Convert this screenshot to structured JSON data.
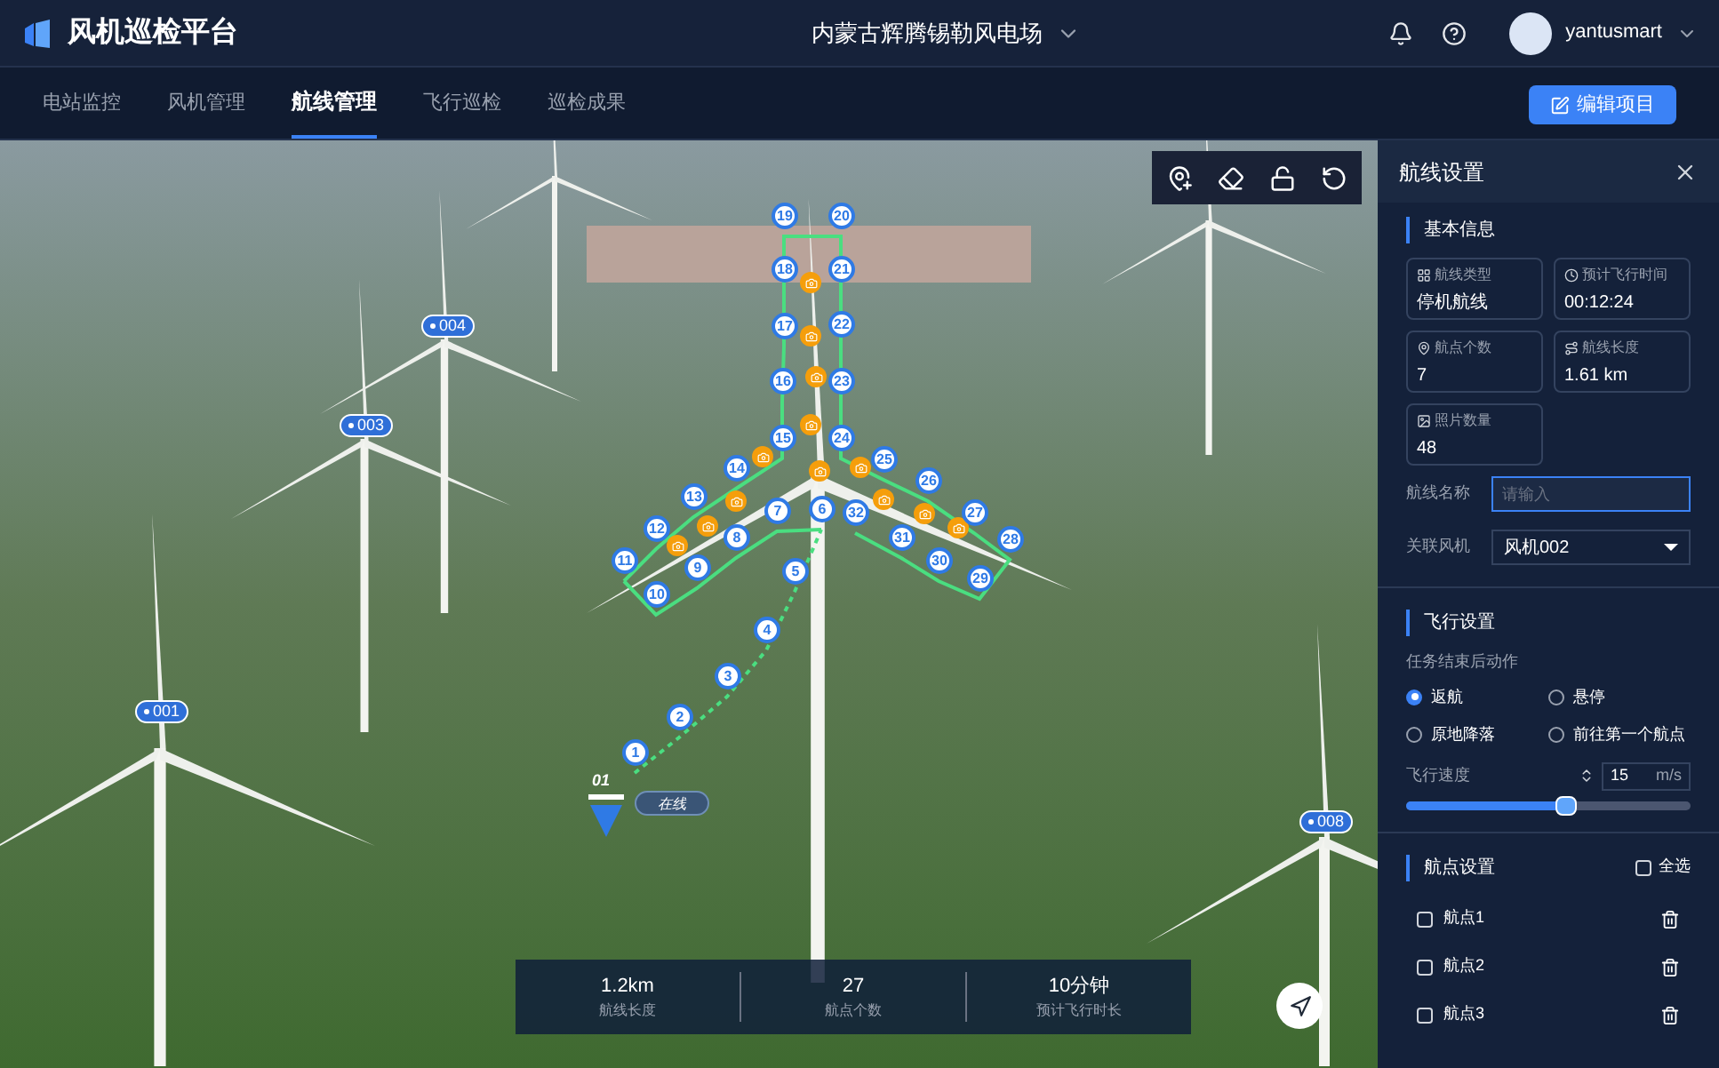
{
  "header": {
    "title": "风机巡检平台",
    "site": "内蒙古辉腾锡勒风电场",
    "user": "yantusmart"
  },
  "tabs": [
    {
      "label": "电站监控",
      "selected": false
    },
    {
      "label": "风机管理",
      "selected": false
    },
    {
      "label": "航线管理",
      "selected": true
    },
    {
      "label": "飞行巡检",
      "selected": false
    },
    {
      "label": "巡检成果",
      "selected": false
    }
  ],
  "edit_button": "编辑项目",
  "map": {
    "turbines": [
      "001",
      "003",
      "004",
      "008"
    ],
    "waypoints": [
      "19",
      "20",
      "18",
      "21",
      "17",
      "22",
      "16",
      "23",
      "15",
      "24",
      "14",
      "25",
      "26",
      "13",
      "7",
      "6",
      "32",
      "27",
      "12",
      "8",
      "31",
      "28",
      "11",
      "9",
      "5",
      "30",
      "29",
      "10",
      "4",
      "3",
      "2",
      "1"
    ],
    "drone": {
      "id": "01",
      "status": "在线"
    },
    "stats": [
      {
        "value": "1.2km",
        "label": "航线长度"
      },
      {
        "value": "27",
        "label": "航点个数"
      },
      {
        "value": "10分钟",
        "label": "预计飞行时长"
      }
    ]
  },
  "panel": {
    "title": "航线设置",
    "basic": {
      "heading": "基本信息",
      "cards": [
        {
          "label": "航线类型",
          "value": "停机航线"
        },
        {
          "label": "预计飞行时间",
          "value": "00:12:24"
        },
        {
          "label": "航点个数",
          "value": "7"
        },
        {
          "label": "航线长度",
          "value": "1.61 km"
        },
        {
          "label": "照片数量",
          "value": "48"
        }
      ],
      "name_label": "航线名称",
      "name_placeholder": "请输入",
      "turbine_label": "关联风机",
      "turbine_value": "风机002"
    },
    "flight": {
      "heading": "飞行设置",
      "action_label": "任务结束后动作",
      "actions": [
        {
          "label": "返航",
          "selected": true
        },
        {
          "label": "悬停",
          "selected": false
        },
        {
          "label": "原地降落",
          "selected": false
        },
        {
          "label": "前往第一个航点",
          "selected": false
        }
      ],
      "speed_label": "飞行速度",
      "speed_value": "15",
      "speed_unit": "m/s",
      "level": 0.56
    },
    "points": {
      "heading": "航点设置",
      "select_all": "全选",
      "select_all_checked": false,
      "items": [
        {
          "label": "航点1",
          "checked": false
        },
        {
          "label": "航点2",
          "checked": false
        },
        {
          "label": "航点3",
          "checked": false
        }
      ]
    }
  }
}
